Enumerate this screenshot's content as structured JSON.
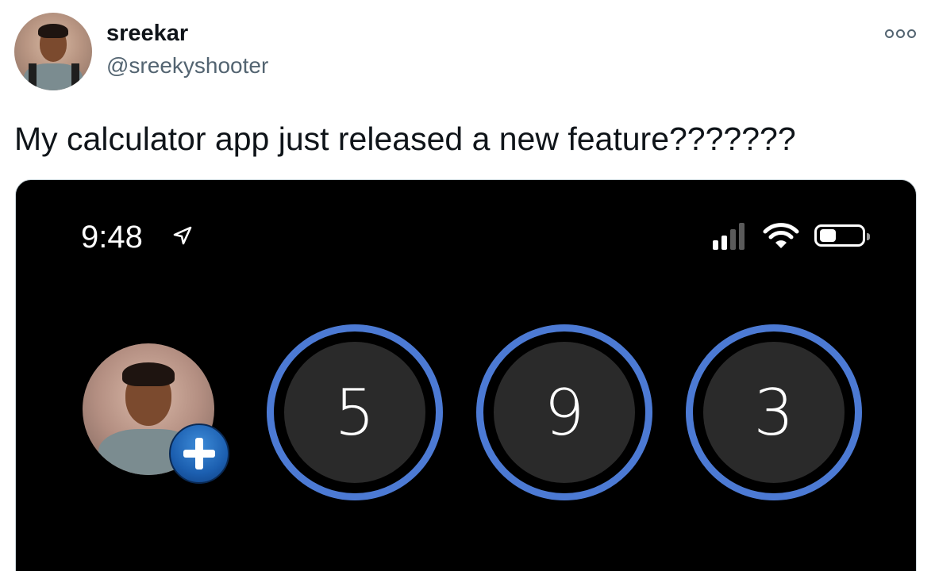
{
  "tweet": {
    "author_name": "sreekar",
    "author_handle": "@sreekyshooter",
    "text": "My calculator app just released a new feature???????"
  },
  "phone": {
    "status_time": "9:48",
    "signal_bars_active": 2,
    "signal_bars_total": 4,
    "battery_level_fraction": 0.4,
    "digits": [
      "5",
      "9",
      "3"
    ]
  },
  "colors": {
    "ring_accent": "#4c7ad4",
    "badge_blue": "#1c5fb0",
    "handle_gray": "#536471"
  },
  "icons": {
    "more": "more-options-icon",
    "location": "location-arrow-icon",
    "signal": "cellular-signal-icon",
    "wifi": "wifi-icon",
    "battery": "battery-icon",
    "add": "plus-icon"
  }
}
